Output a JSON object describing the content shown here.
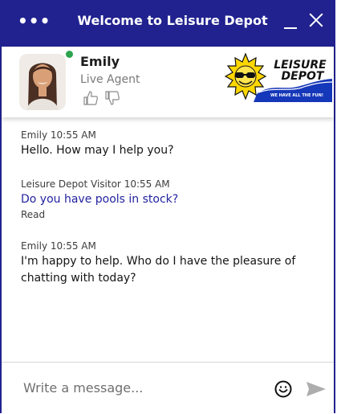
{
  "header": {
    "title": "Welcome to Leisure Depot",
    "menu_icon": "more-dots-icon",
    "minimize_icon": "minimize-icon",
    "close_icon": "close-icon",
    "background_color": "#21228f"
  },
  "agent": {
    "name": "Emily",
    "role": "Live Agent",
    "status_color": "#2da44e",
    "status": "online",
    "thumb_up_icon": "thumbs-up-icon",
    "thumb_down_icon": "thumbs-down-icon"
  },
  "logo": {
    "line1": "LEISURE",
    "line2": "DEPOT",
    "tagline": "WE HAVE ALL THE FUN!"
  },
  "messages": [
    {
      "sender": "Emily",
      "time": "10:55 AM",
      "text": "Hello. How may I help you?"
    },
    {
      "sender": "Leisure Depot Visitor",
      "time": "10:55 AM",
      "text": "Do you have pools in stock?",
      "status": "Read"
    },
    {
      "sender": "Emily",
      "time": "10:55 AM",
      "text": "I'm happy to help. Who do I have the pleasure of chatting with today?"
    }
  ],
  "composer": {
    "placeholder": "Write a message...",
    "emoji_icon": "emoji-icon",
    "send_icon": "send-icon"
  }
}
